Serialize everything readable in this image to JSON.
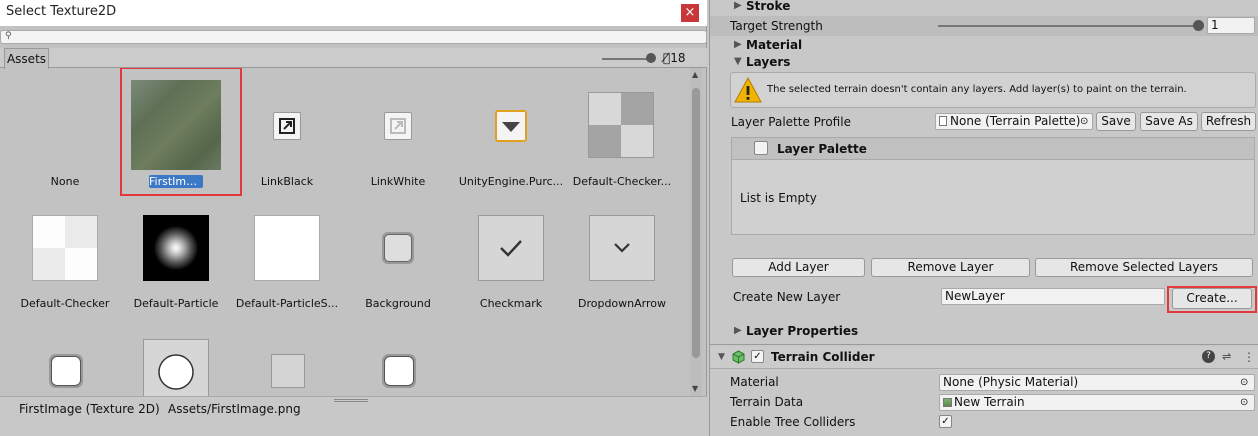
{
  "picker": {
    "title": "Select Texture2D",
    "close_glyph": "×",
    "tab_assets": "Assets",
    "hidden_count": "18",
    "status_name": "FirstImage (Texture 2D)",
    "status_path": "Assets/FirstImage.png",
    "items": [
      {
        "label": "None"
      },
      {
        "label": "FirstImage"
      },
      {
        "label": "LinkBlack"
      },
      {
        "label": "LinkWhite"
      },
      {
        "label": "UnityEngine.Purc..."
      },
      {
        "label": "Default-Checker..."
      },
      {
        "label": "Default-Checker"
      },
      {
        "label": "Default-Particle"
      },
      {
        "label": "Default-ParticleS..."
      },
      {
        "label": "Background"
      },
      {
        "label": "Checkmark"
      },
      {
        "label": "DropdownArrow"
      }
    ]
  },
  "inspector": {
    "stroke": "Stroke",
    "target_strength_label": "Target Strength",
    "target_strength_value": "1",
    "material": "Material",
    "layers": "Layers",
    "help_message": "The selected terrain doesn't contain any layers. Add layer(s) to paint on the terrain.",
    "palette_profile_label": "Layer Palette Profile",
    "palette_profile_value": "None (Terrain Palette)",
    "save": "Save",
    "save_as": "Save As",
    "refresh": "Refresh",
    "layer_palette": "Layer Palette",
    "list_empty": "List is Empty",
    "add_layer": "Add Layer",
    "remove_layer": "Remove Layer",
    "remove_selected_layers": "Remove Selected Layers",
    "create_new_layer_label": "Create New Layer",
    "create_new_layer_value": "NewLayer",
    "create": "Create...",
    "layer_properties": "Layer Properties",
    "terrain_collider": "Terrain Collider",
    "collider_material_label": "Material",
    "collider_material_value": "None (Physic Material)",
    "terrain_data_label": "Terrain Data",
    "terrain_data_value": "New Terrain",
    "enable_tree_colliders_label": "Enable Tree Colliders",
    "check_glyph": "✓"
  },
  "colors": {
    "highlight": "#e03a3a",
    "selection": "#3b78c6"
  }
}
